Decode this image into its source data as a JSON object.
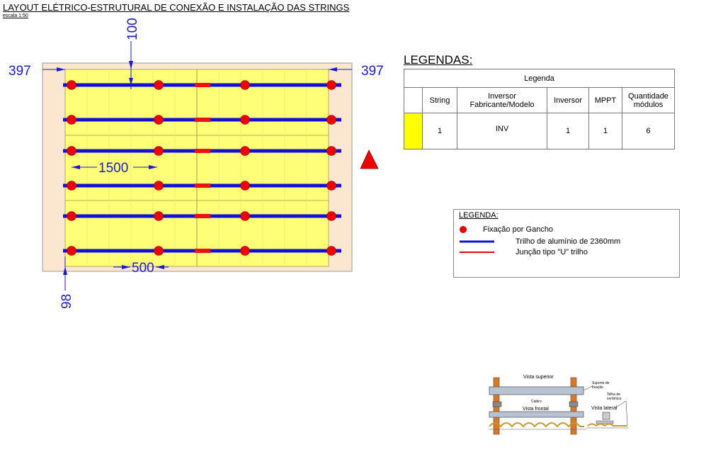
{
  "header": {
    "title": "LAYOUT ELÉTRICO-ESTRUTURAL DE CONEXÃO E INSTALAÇÃO DAS STRINGS",
    "scale": "escala 1:50"
  },
  "dimensions": {
    "left_margin": "397",
    "right_margin": "397",
    "top_offset": "100",
    "bottom_offset": "98",
    "rafter_spacing": "1500",
    "end_spacing": "500"
  },
  "layout": {
    "rails": 6,
    "hooks_per_rail": 4,
    "colors": {
      "roof": "#fbe7cf",
      "module": "#ffff77",
      "rail": "#1010d8",
      "hook": "#ee0000",
      "junction": "#ee1111",
      "dimension": "#1a1ad6",
      "north_marker": "#ee0000"
    }
  },
  "legend_table": {
    "section_title": "LEGENDAS:",
    "table_title": "Legenda",
    "headers": {
      "string": "String",
      "inverter_model_line1": "Inversor",
      "inverter_model_line2": "Fabricante/Modelo",
      "inverter": "Inversor",
      "mppt": "MPPT",
      "qty_line1": "Quantidade",
      "qty_line2": "módulos"
    },
    "rows": [
      {
        "color": "#ffff00",
        "string": "1",
        "model": "INV",
        "inverter": "1",
        "mppt": "1",
        "qty": "6"
      }
    ]
  },
  "legend_box": {
    "title": "LEGENDA:",
    "items": [
      {
        "icon": "hook-dot-icon",
        "label": "Fixação por Gancho"
      },
      {
        "icon": "blue-line-icon",
        "label": "Trilho de alumínio de  2360mm"
      },
      {
        "icon": "red-line-icon",
        "label": "Junção tipo \"U\" trilho"
      }
    ]
  },
  "detail": {
    "top_view": "Vista superior",
    "support_line1": "Suporte de",
    "support_line2": "fixação",
    "tile_line1": "Telha de",
    "tile_line2": "cerâmica",
    "rafter": "Caibro",
    "front_view": "Vista frontal",
    "side_view": "Vista lateral"
  }
}
